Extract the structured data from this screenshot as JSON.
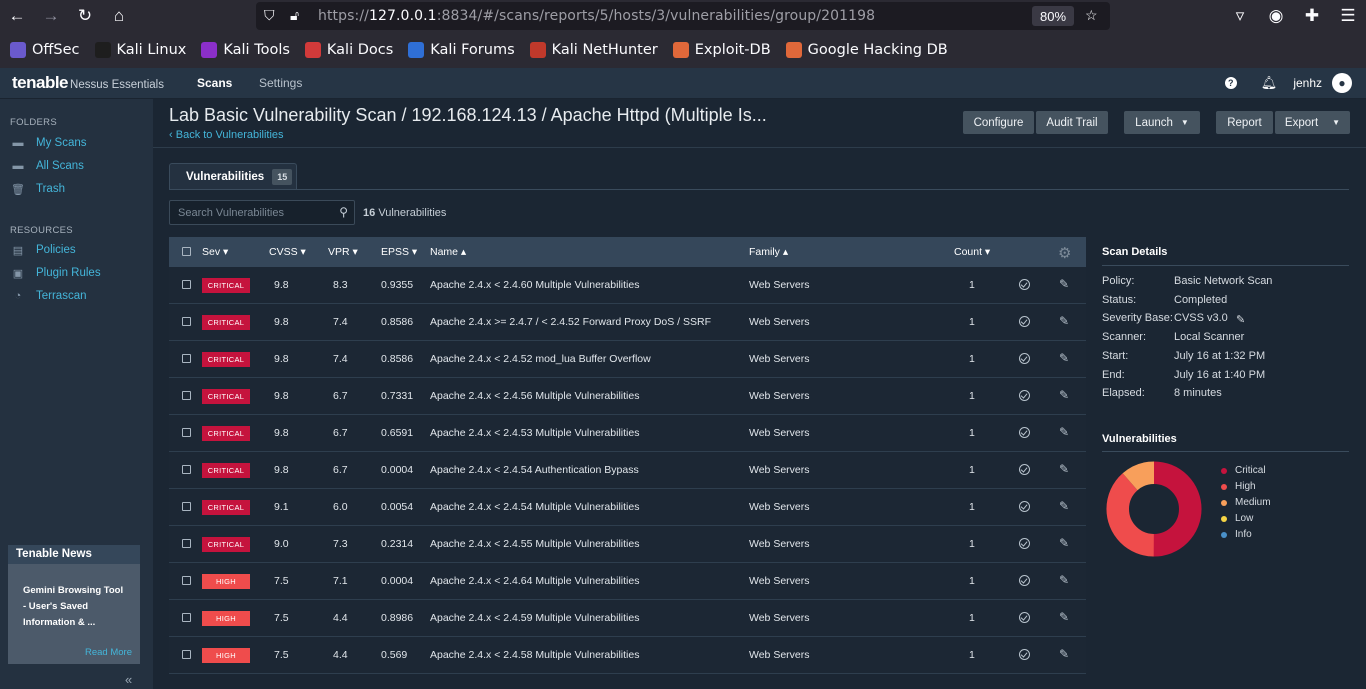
{
  "browser": {
    "url_prefix": "https://",
    "url_host": "127.0.0.1",
    "url_rest": ":8834/#/scans/reports/5/hosts/3/vulnerabilities/group/201198",
    "zoom": "80%",
    "bookmarks": [
      {
        "label": "OffSec",
        "color": "#6a5acd"
      },
      {
        "label": "Kali Linux",
        "color": "#1e1e1e"
      },
      {
        "label": "Kali Tools",
        "color": "#8b2fc9"
      },
      {
        "label": "Kali Docs",
        "color": "#d23a3a"
      },
      {
        "label": "Kali Forums",
        "color": "#2f6fd6"
      },
      {
        "label": "Kali NetHunter",
        "color": "#c0392b"
      },
      {
        "label": "Exploit-DB",
        "color": "#e0683a"
      },
      {
        "label": "Google Hacking DB",
        "color": "#e0683a"
      }
    ]
  },
  "app": {
    "logo": "tenable",
    "logo_sub": "Nessus Essentials",
    "nav_scans": "Scans",
    "nav_settings": "Settings",
    "user": "jenhz"
  },
  "sidebar": {
    "folders_head": "FOLDERS",
    "folders": [
      "My Scans",
      "All Scans",
      "Trash"
    ],
    "resources_head": "RESOURCES",
    "resources": [
      "Policies",
      "Plugin Rules",
      "Terrascan"
    ],
    "news_title": "Tenable News",
    "news_text": "Gemini Browsing Tool - User's Saved Information & ...",
    "news_more": "Read More",
    "collapse": "«"
  },
  "header": {
    "title": "Lab Basic Vulnerability Scan / 192.168.124.13 / Apache Httpd (Multiple Is...",
    "back": "Back to Vulnerabilities",
    "configure": "Configure",
    "audit_trail": "Audit Trail",
    "launch": "Launch",
    "report": "Report",
    "export": "Export"
  },
  "tabs": {
    "vulnerabilities": "Vulnerabilities",
    "count": "15"
  },
  "search": {
    "placeholder": "Search Vulnerabilities",
    "count_num": "16",
    "count_label": "Vulnerabilities"
  },
  "table": {
    "headers": {
      "sev": "Sev ▾",
      "cvss": "CVSS ▾",
      "vpr": "VPR ▾",
      "epss": "EPSS ▾",
      "name": "Name ▴",
      "family": "Family ▴",
      "count": "Count ▾"
    },
    "rows": [
      {
        "sev": "CRITICAL",
        "cvss": "9.8",
        "vpr": "8.3",
        "epss": "0.9355",
        "name": "Apache 2.4.x < 2.4.60 Multiple Vulnerabilities",
        "family": "Web Servers",
        "count": "1"
      },
      {
        "sev": "CRITICAL",
        "cvss": "9.8",
        "vpr": "7.4",
        "epss": "0.8586",
        "name": "Apache 2.4.x >= 2.4.7 / < 2.4.52 Forward Proxy DoS / SSRF",
        "family": "Web Servers",
        "count": "1"
      },
      {
        "sev": "CRITICAL",
        "cvss": "9.8",
        "vpr": "7.4",
        "epss": "0.8586",
        "name": "Apache 2.4.x < 2.4.52 mod_lua Buffer Overflow",
        "family": "Web Servers",
        "count": "1"
      },
      {
        "sev": "CRITICAL",
        "cvss": "9.8",
        "vpr": "6.7",
        "epss": "0.7331",
        "name": "Apache 2.4.x < 2.4.56 Multiple Vulnerabilities",
        "family": "Web Servers",
        "count": "1"
      },
      {
        "sev": "CRITICAL",
        "cvss": "9.8",
        "vpr": "6.7",
        "epss": "0.6591",
        "name": "Apache 2.4.x < 2.4.53 Multiple Vulnerabilities",
        "family": "Web Servers",
        "count": "1"
      },
      {
        "sev": "CRITICAL",
        "cvss": "9.8",
        "vpr": "6.7",
        "epss": "0.0004",
        "name": "Apache 2.4.x < 2.4.54 Authentication Bypass",
        "family": "Web Servers",
        "count": "1"
      },
      {
        "sev": "CRITICAL",
        "cvss": "9.1",
        "vpr": "6.0",
        "epss": "0.0054",
        "name": "Apache 2.4.x < 2.4.54 Multiple Vulnerabilities",
        "family": "Web Servers",
        "count": "1"
      },
      {
        "sev": "CRITICAL",
        "cvss": "9.0",
        "vpr": "7.3",
        "epss": "0.2314",
        "name": "Apache 2.4.x < 2.4.55 Multiple Vulnerabilities",
        "family": "Web Servers",
        "count": "1"
      },
      {
        "sev": "HIGH",
        "cvss": "7.5",
        "vpr": "7.1",
        "epss": "0.0004",
        "name": "Apache 2.4.x < 2.4.64 Multiple Vulnerabilities",
        "family": "Web Servers",
        "count": "1"
      },
      {
        "sev": "HIGH",
        "cvss": "7.5",
        "vpr": "4.4",
        "epss": "0.8986",
        "name": "Apache 2.4.x < 2.4.59 Multiple Vulnerabilities",
        "family": "Web Servers",
        "count": "1"
      },
      {
        "sev": "HIGH",
        "cvss": "7.5",
        "vpr": "4.4",
        "epss": "0.569",
        "name": "Apache 2.4.x < 2.4.58 Multiple Vulnerabilities",
        "family": "Web Servers",
        "count": "1"
      }
    ]
  },
  "scan_details": {
    "title": "Scan Details",
    "items": [
      {
        "label": "Policy:",
        "value": "Basic Network Scan"
      },
      {
        "label": "Status:",
        "value": "Completed"
      },
      {
        "label": "Severity Base:",
        "value": "CVSS v3.0"
      },
      {
        "label": "Scanner:",
        "value": "Local Scanner"
      },
      {
        "label": "Start:",
        "value": "July 16 at 1:32 PM"
      },
      {
        "label": "End:",
        "value": "July 16 at 1:40 PM"
      },
      {
        "label": "Elapsed:",
        "value": "8 minutes"
      }
    ]
  },
  "vuln_chart": {
    "title": "Vulnerabilities",
    "legend": [
      {
        "label": "Critical",
        "color": "#c5133d"
      },
      {
        "label": "High",
        "color": "#ef4c4c"
      },
      {
        "label": "Medium",
        "color": "#f89f5b"
      },
      {
        "label": "Low",
        "color": "#f6d545"
      },
      {
        "label": "Info",
        "color": "#4a90c9"
      }
    ]
  }
}
